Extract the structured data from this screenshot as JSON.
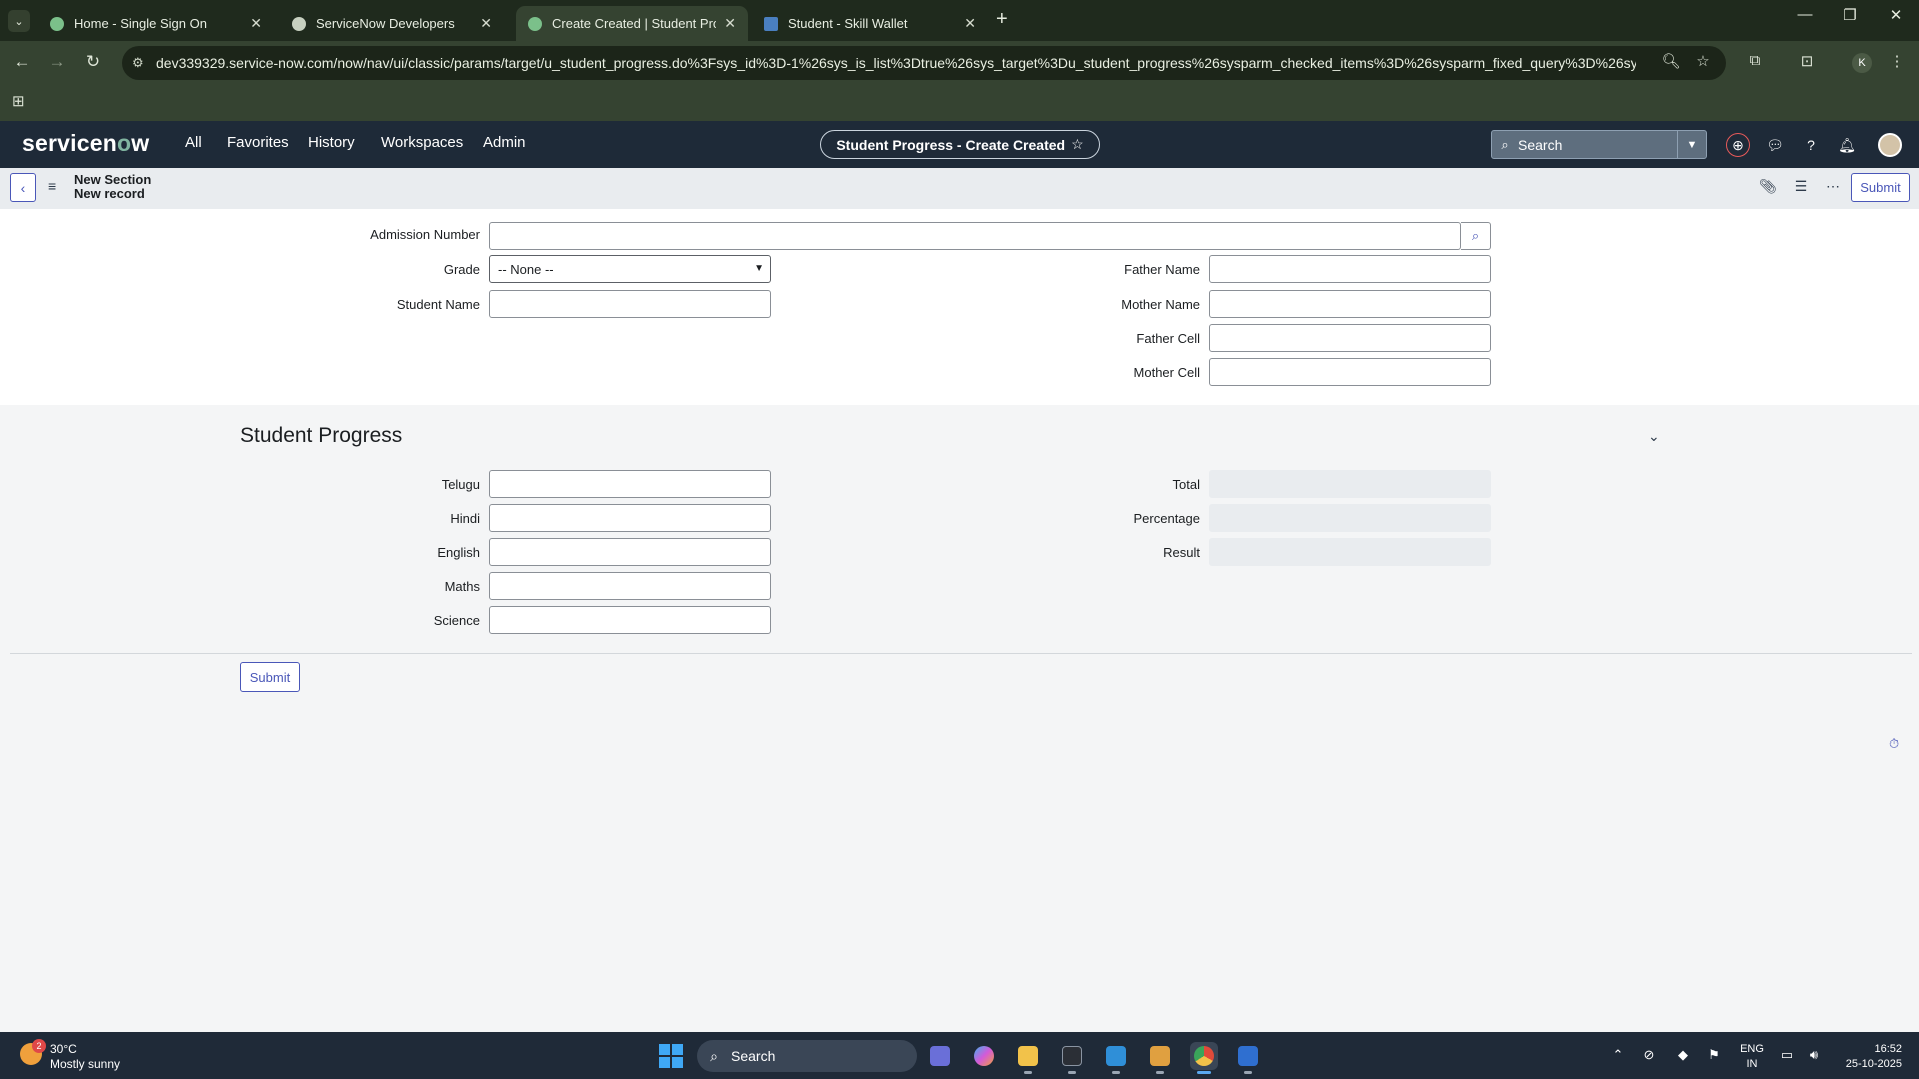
{
  "browser": {
    "tabs": [
      {
        "title": "Home - Single Sign On",
        "active": false,
        "favicon_color": "#7bc08a"
      },
      {
        "title": "ServiceNow Developers",
        "active": false,
        "favicon_color": "#c7d0c0"
      },
      {
        "title": "Create Created | Student Progr",
        "active": true,
        "favicon_color": "#7bc08a"
      },
      {
        "title": "Student - Skill Wallet",
        "active": false,
        "favicon_color": "#4a7fc0"
      }
    ],
    "new_tab": "+",
    "url": "dev339329.service-now.com/now/nav/ui/classic/params/target/u_student_progress.do%3Fsys_id%3D-1%26sys_is_list%3Dtrue%26sys_target%3Du_student_progress%26sysparm_checked_items%3D%26sysparm_fixed_query%3D%26sysparm_...",
    "profile_initial": "K"
  },
  "servicenow": {
    "logo_pre": "servicen",
    "logo_o": "o",
    "logo_post": "w",
    "nav": [
      "All",
      "Favorites",
      "History",
      "Workspaces",
      "Admin"
    ],
    "page_title": "Student Progress - Create Created",
    "star": "☆",
    "search_placeholder": "Search"
  },
  "form_header": {
    "line1": "New Section",
    "line2": "New record",
    "submit_label": "Submit"
  },
  "form": {
    "fields_left": [
      {
        "label": "Admission Number"
      },
      {
        "label": "Grade",
        "select_value": "-- None --"
      },
      {
        "label": "Student Name"
      }
    ],
    "fields_right": [
      {
        "label": "Father Name"
      },
      {
        "label": "Mother Name"
      },
      {
        "label": "Father Cell"
      },
      {
        "label": "Mother Cell"
      }
    ]
  },
  "section": {
    "title": "Student Progress",
    "subjects": [
      "Telugu",
      "Hindi",
      "English",
      "Maths",
      "Science"
    ],
    "computed": [
      "Total",
      "Percentage",
      "Result"
    ],
    "submit_label": "Submit"
  },
  "taskbar": {
    "temp": "30°C",
    "weather": "Mostly sunny",
    "badge": "2",
    "search": "Search",
    "lang1": "ENG",
    "lang2": "IN",
    "time": "16:52",
    "date": "25-10-2025"
  }
}
